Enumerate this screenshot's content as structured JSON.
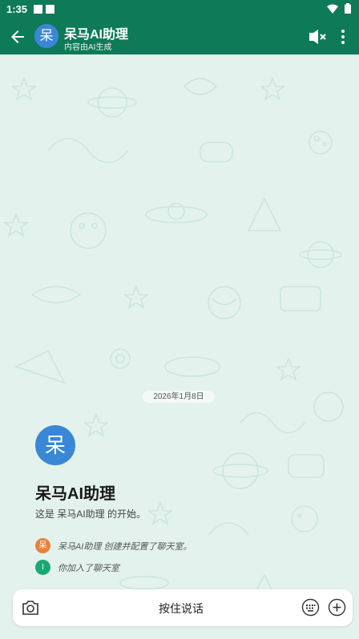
{
  "status": {
    "time": "1:35"
  },
  "header": {
    "avatar_char": "呆",
    "title": "呆马AI助理",
    "subtitle": "内容由AI生成"
  },
  "chat": {
    "date": "2026年1月8日",
    "avatar_char": "呆",
    "name": "呆马AI助理",
    "intro": "这是 呆马AI助理 的开始。",
    "events": [
      {
        "avatar": "呆",
        "color": "#e8823a",
        "text": "呆马AI助理 创建并配置了聊天室。"
      },
      {
        "avatar": "I",
        "color": "#1aa874",
        "text": "你加入了聊天室"
      }
    ]
  },
  "input": {
    "press_to_talk": "按住说话"
  },
  "colors": {
    "primary": "#0f7a58",
    "avatar": "#3a87d6",
    "background": "#e3f2ec"
  }
}
